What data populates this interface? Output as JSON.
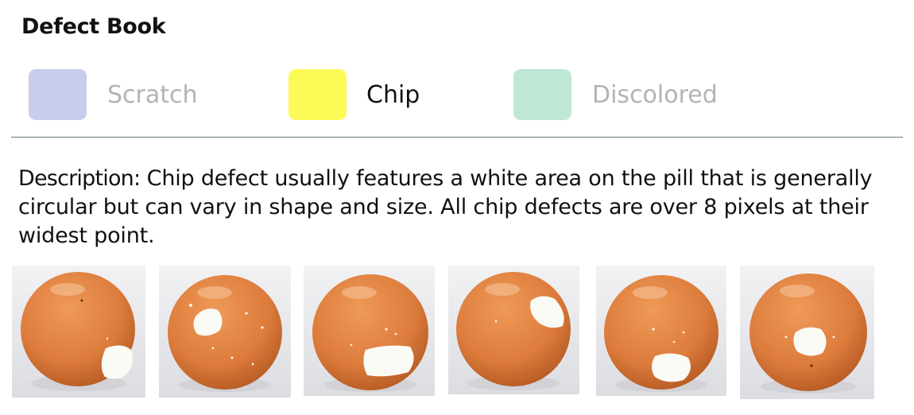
{
  "header": {
    "title": "Defect Book"
  },
  "tabs": [
    {
      "label": "Scratch",
      "color": "#c7cdeb",
      "selected": false
    },
    {
      "label": "Chip",
      "color": "#fcfa57",
      "selected": true
    },
    {
      "label": "Discolored",
      "color": "#bfe7d6",
      "selected": false
    }
  ],
  "description": {
    "label": "Description:",
    "text": "Chip defect usually features a white area on the pill that is generally circular but can vary in shape and size. All chip defects are over 8 pixels at their widest point."
  },
  "gallery": {
    "image_count": 6
  }
}
